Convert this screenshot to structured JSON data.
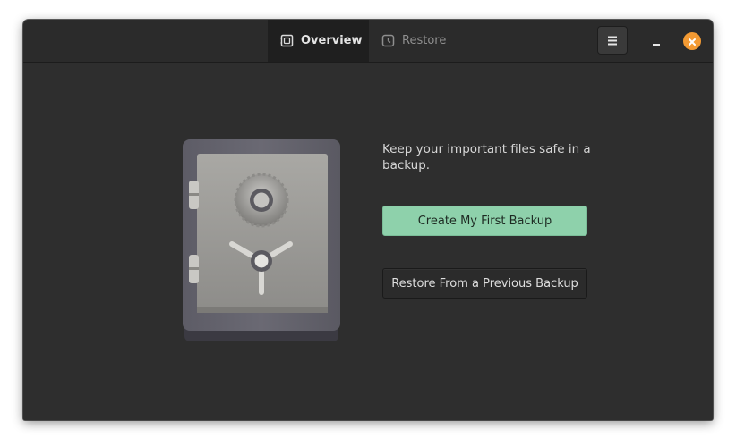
{
  "header": {
    "tabs": [
      {
        "label": "Overview",
        "icon": "overview-icon",
        "active": true
      },
      {
        "label": "Restore",
        "icon": "clock-icon",
        "active": false
      }
    ],
    "menu_icon": "hamburger-menu-icon",
    "minimize_icon": "minimize-icon",
    "close_icon": "close-icon"
  },
  "main": {
    "illustration": "safe-icon",
    "tagline": "Keep your important files safe in a backup.",
    "primary_button": "Create My First Backup",
    "secondary_button": "Restore From a Previous Backup"
  },
  "colors": {
    "window_bg": "#2e2e2e",
    "accent_green": "#8ed1ab",
    "close_orange": "#f39a33"
  }
}
